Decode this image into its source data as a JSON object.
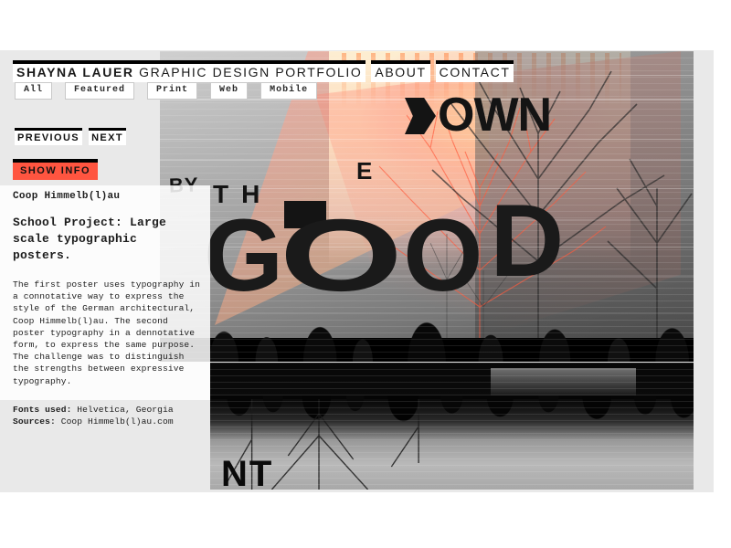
{
  "site": {
    "brand": "SHAYNA LAUER",
    "tagline": "GRAPHIC DESIGN PORTFOLIO",
    "nav": [
      {
        "label": "ABOUT"
      },
      {
        "label": "CONTACT"
      }
    ]
  },
  "filters": [
    {
      "label": "All"
    },
    {
      "label": "Featured"
    },
    {
      "label": "Print"
    },
    {
      "label": "Web"
    },
    {
      "label": "Mobile"
    }
  ],
  "pager": {
    "previous": "PREVIOUS",
    "next": "NEXT"
  },
  "toggle": {
    "show_info": "SHOW INFO"
  },
  "project": {
    "title": "Coop Himmelb(l)au",
    "subtitle": "School Project: Large scale typographic posters.",
    "body": "The first poster uses typography in a connotative way to express the style of the German architectural, Coop Himmelb(l)au. The second poster typography in a dennotative form, to express the same purpose. The challenge was to distinguish the strengths between expressive typography.",
    "fonts_label": "Fonts used:",
    "fonts_value": " Helvetica, Georgia",
    "sources_label": "Sources:",
    "sources_value": " Coop Himmelb(l)au.com"
  },
  "artwork": {
    "poster_top": {
      "word_down": "OWN",
      "word_by": "BY",
      "word_the": "TH",
      "word_e": "E",
      "word_good_g": "G",
      "word_good_o1": "O",
      "word_good_o2": "O",
      "word_good_d": "D"
    },
    "poster_bottom": {
      "partial_word": "NT"
    }
  },
  "colors": {
    "accent_red": "#ff5540",
    "page_background": "#e9e9e9",
    "outer_background": "#ffffff",
    "nav_bar": "#000000",
    "text": "#1a1a1a"
  }
}
